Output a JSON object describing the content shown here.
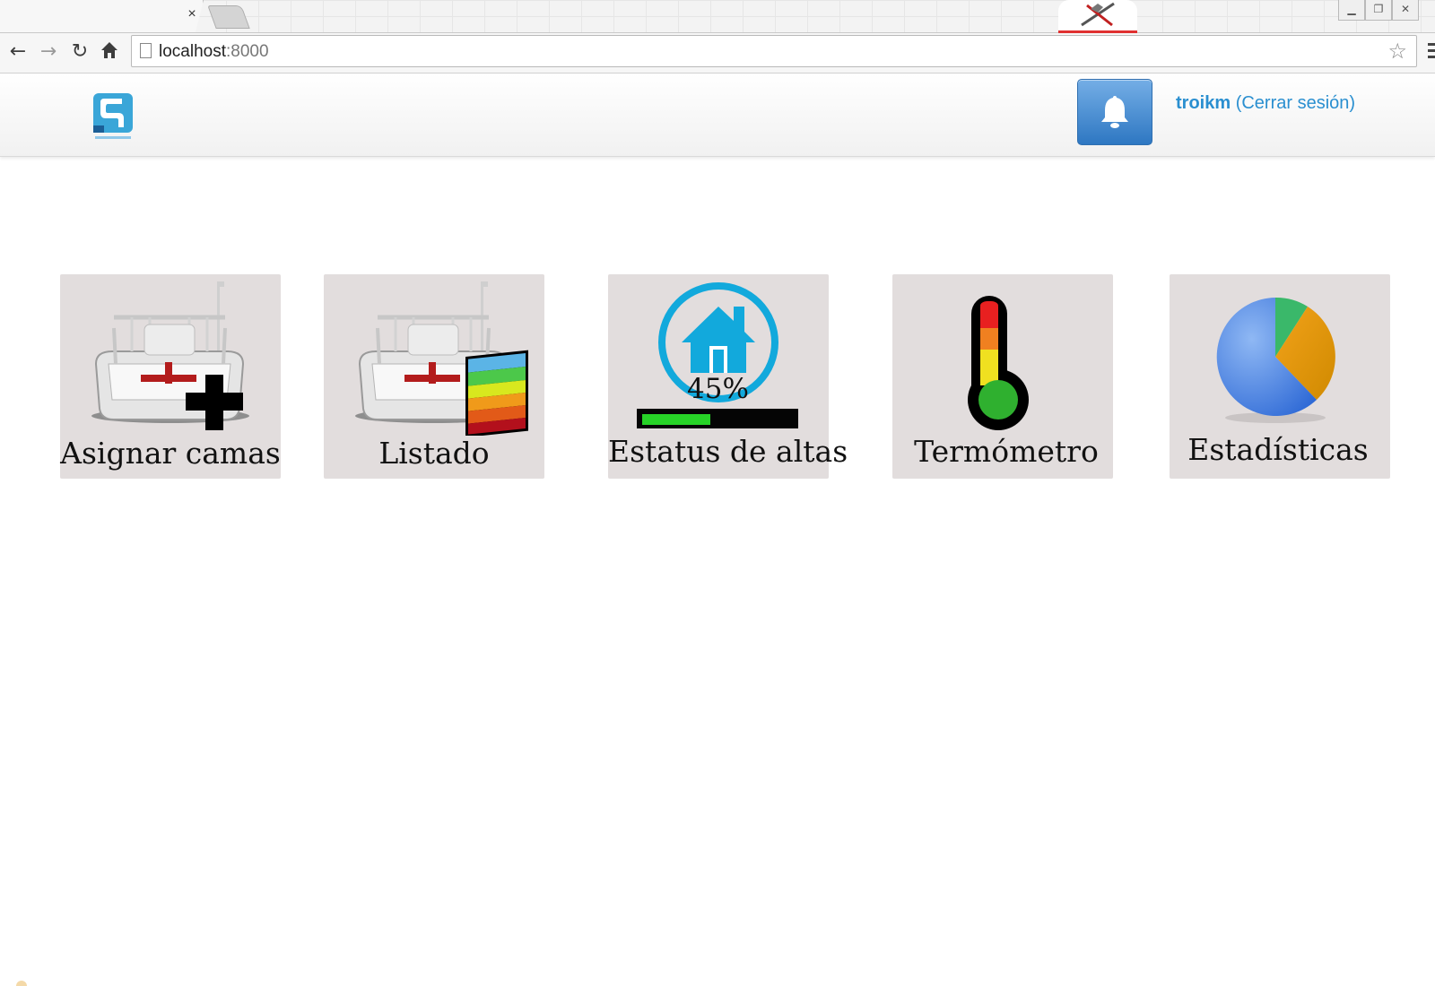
{
  "browser": {
    "tab_close_glyph": "×",
    "url_host": "localhost",
    "url_port": ":8000",
    "nav_icons": [
      "back-icon",
      "forward-icon",
      "reload-icon",
      "home-icon"
    ],
    "window_controls": [
      "minimize-icon",
      "restore-icon",
      "close-icon"
    ]
  },
  "header": {
    "logo_icon": "medmatic-logo",
    "notifications_icon": "bell-icon",
    "username": "troikm",
    "logout_label": "(Cerrar sesión)",
    "accent_color": "#2a8fd0"
  },
  "tiles": [
    {
      "label": "Asignar camas",
      "icon": "hospital-bed-plus-icon"
    },
    {
      "label": "Listado",
      "icon": "hospital-bed-list-icon"
    },
    {
      "label": "Estatus de altas",
      "icon": "house-progress-icon",
      "percent_text": "45%",
      "progress": 0.45
    },
    {
      "label": "Termómetro",
      "icon": "thermometer-icon"
    },
    {
      "label": "Estadísticas",
      "icon": "pie-chart-icon"
    }
  ]
}
